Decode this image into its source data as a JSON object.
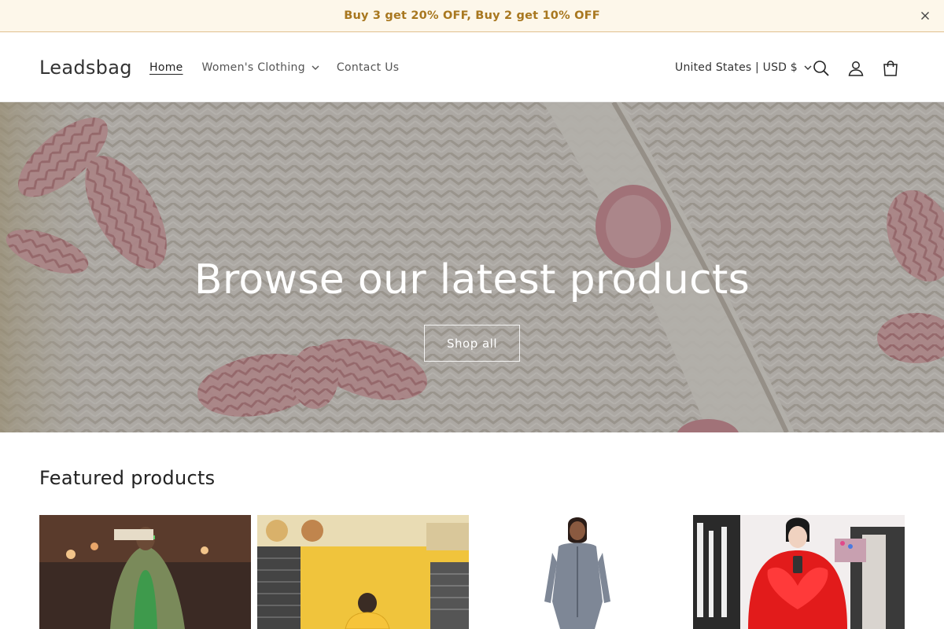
{
  "announcement": {
    "text": "Buy 3 get 20% OFF, Buy 2 get 10% OFF",
    "close_icon": "close-icon"
  },
  "header": {
    "logo": "Leadsbag",
    "nav": [
      {
        "label": "Home",
        "active": true
      },
      {
        "label": "Women's Clothing",
        "dropdown": true
      },
      {
        "label": "Contact Us"
      }
    ],
    "country_selector": "United States | USD $",
    "icons": [
      "search-icon",
      "account-icon",
      "cart-icon"
    ]
  },
  "hero": {
    "title": "Browse our latest products",
    "button": "Shop all"
  },
  "featured": {
    "title": "Featured products",
    "products": [
      {
        "image": "product-image-green-sequin-dress-fur-coat"
      },
      {
        "image": "product-image-yellow-hoodie-storefront"
      },
      {
        "image": "product-image-denim-zip-romper"
      },
      {
        "image": "product-image-red-fur-coat"
      }
    ]
  },
  "colors": {
    "announcement_bg": "#fdf7ea",
    "announcement_text": "#a8771f"
  }
}
